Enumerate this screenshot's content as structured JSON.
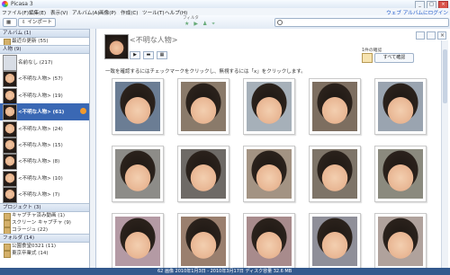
{
  "window": {
    "title": "Picasa 3",
    "min": "_",
    "max": "□",
    "close": "×"
  },
  "menu": {
    "items": [
      "ファイル(F)",
      "編集(E)",
      "表示(V)",
      "アルバム(A)",
      "画像(P)",
      "作成(C)",
      "ツール(T)",
      "ヘルプ(H)"
    ],
    "web_link": "ウェブ アルバムにログイン"
  },
  "toolbar": {
    "import_label": "インポート",
    "filter_label": "フィルタ",
    "filter_icons": [
      "★",
      "▶",
      "♟",
      "⌖"
    ]
  },
  "sidebar": {
    "albums_header": "アルバム (1)",
    "albums": [
      {
        "label": "最近の更新 (55)"
      }
    ],
    "people_header": "人物 (9)",
    "people": [
      {
        "label": "名前なし (217)"
      },
      {
        "label": "<不明な人物> (57)"
      },
      {
        "label": "<不明な人物> (19)"
      },
      {
        "label": "<不明な人物> (61)",
        "selected": true
      },
      {
        "label": "<不明な人物> (24)"
      },
      {
        "label": "<不明な人物> (15)"
      },
      {
        "label": "<不明な人物> (8)"
      },
      {
        "label": "<不明な人物> (10)"
      },
      {
        "label": "<不明な人物> (7)"
      }
    ],
    "projects_header": "プロジェクト (3)",
    "projects": [
      {
        "label": "キャプチャ済み動画 (1)"
      },
      {
        "label": "スクリーン キャプチャ (9)"
      },
      {
        "label": "コラージュ (22)"
      }
    ],
    "folders_header": "フォルダ (14)",
    "folders": [
      {
        "label": "公園食堂0321 (11)"
      },
      {
        "label": "東京卒業式 (14)"
      }
    ]
  },
  "main": {
    "title": "<不明な人物>",
    "instruction": "一致を確認するにはチェックマークをクリックし、無視するには「x」をクリックします。",
    "info": "1件の確認",
    "confirm_label": "すべて確認",
    "close": "×",
    "buttons": [
      "▶",
      "▬",
      "▦"
    ]
  },
  "status": {
    "text": "62 画像    2010年1月3日 - 2010年3月17日    ディスク容量 32.6 MB"
  },
  "photos": [
    {
      "bg": "#6b7d94"
    },
    {
      "bg": "#8a7a6a"
    },
    {
      "bg": "#a6b0b9"
    },
    {
      "bg": "#7d6e60"
    },
    {
      "bg": "#9aa4b0"
    },
    {
      "bg": "#8d8c88"
    },
    {
      "bg": "#6e6a66"
    },
    {
      "bg": "#a39383"
    },
    {
      "bg": "#7e7468"
    },
    {
      "bg": "#8b8a7e"
    },
    {
      "bg": "#b49aa4"
    },
    {
      "bg": "#9a7f6e"
    },
    {
      "bg": "#a88b8c"
    },
    {
      "bg": "#8f8f99"
    },
    {
      "bg": "#b0a29c"
    }
  ]
}
